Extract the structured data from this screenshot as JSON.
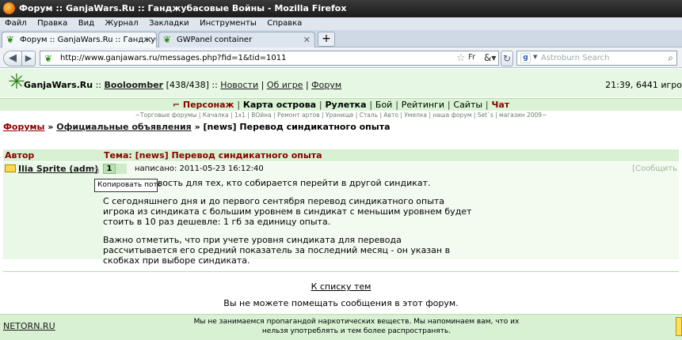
{
  "window": {
    "title": "Форум :: GanjaWars.Ru :: Ганджубасовые Войны - Mozilla Firefox"
  },
  "menu": [
    "Файл",
    "Правка",
    "Вид",
    "Журнал",
    "Закладки",
    "Инструменты",
    "Справка"
  ],
  "tabs": [
    {
      "label": "Форум :: GanjaWars.Ru :: Ганджубасов...",
      "active": true
    },
    {
      "label": "GWPanel container",
      "active": false
    }
  ],
  "navbar": {
    "url": "http://www.ganjawars.ru/messages.php?fid=1&tid=1011",
    "search_placeholder": "Astroburn Search"
  },
  "site": {
    "name": "GanjaWars.Ru",
    "user": "Booloomber",
    "hp": "[438/438]",
    "links": [
      "Новости",
      "Об игре",
      "Форум"
    ],
    "time_online": "21:39, 6441 игро",
    "main_menu": [
      "Персонаж",
      "Карта острова",
      "Рулетка",
      "Бой",
      "Рейтинги",
      "Сайты",
      "Чат"
    ],
    "sub_menu": "~Торговые форумы | Качалка | 1x1 | ВОйна | Ремонт артов | Уранище | Сталь | Авто | Умелка | наша форум | Set`s | магазин 2009~"
  },
  "breadcrumb": {
    "forums": "Форумы",
    "section": "Официальные объявления",
    "current": "[news] Перевод синдикатного опыта"
  },
  "thread": {
    "author_header": "Автор",
    "topic_header": "Тема: [news] Перевод синдикатного опыта",
    "post": {
      "author": "Ilia Sprite (adm)",
      "number": "1",
      "written": "написано: 2011-05-23 16:12:40",
      "reply_label": "[Сообщить",
      "tooltip": "Копировать потс",
      "paragraphs": [
        "Хорошая новость для тех, кто собирается перейти в другой синдикат.",
        "С сегодняшнего дня и до первого сентября перевод синдикатного опыта игрока из синдиката с большим уровнем в синдикат с меньшим уровнем будет стоить в 10 раз дешевле: 1 гб за единицу опыта.",
        "Важно отметить, что при учете уровня синдиката для перевода рассчитывается его средний показатель за последний месяц - он указан в скобках при выборе синдиката."
      ]
    }
  },
  "to_list": "К списку тем",
  "cannot_post": "Вы не можете помещать сообщения в этот форум.",
  "footer": {
    "netorn": "NETORN.RU",
    "disclaimer": "Мы не занимаемся пропагандой наркотических веществ. Мы напоминаем вам, что их нельзя употреблять и тем более распространять."
  }
}
